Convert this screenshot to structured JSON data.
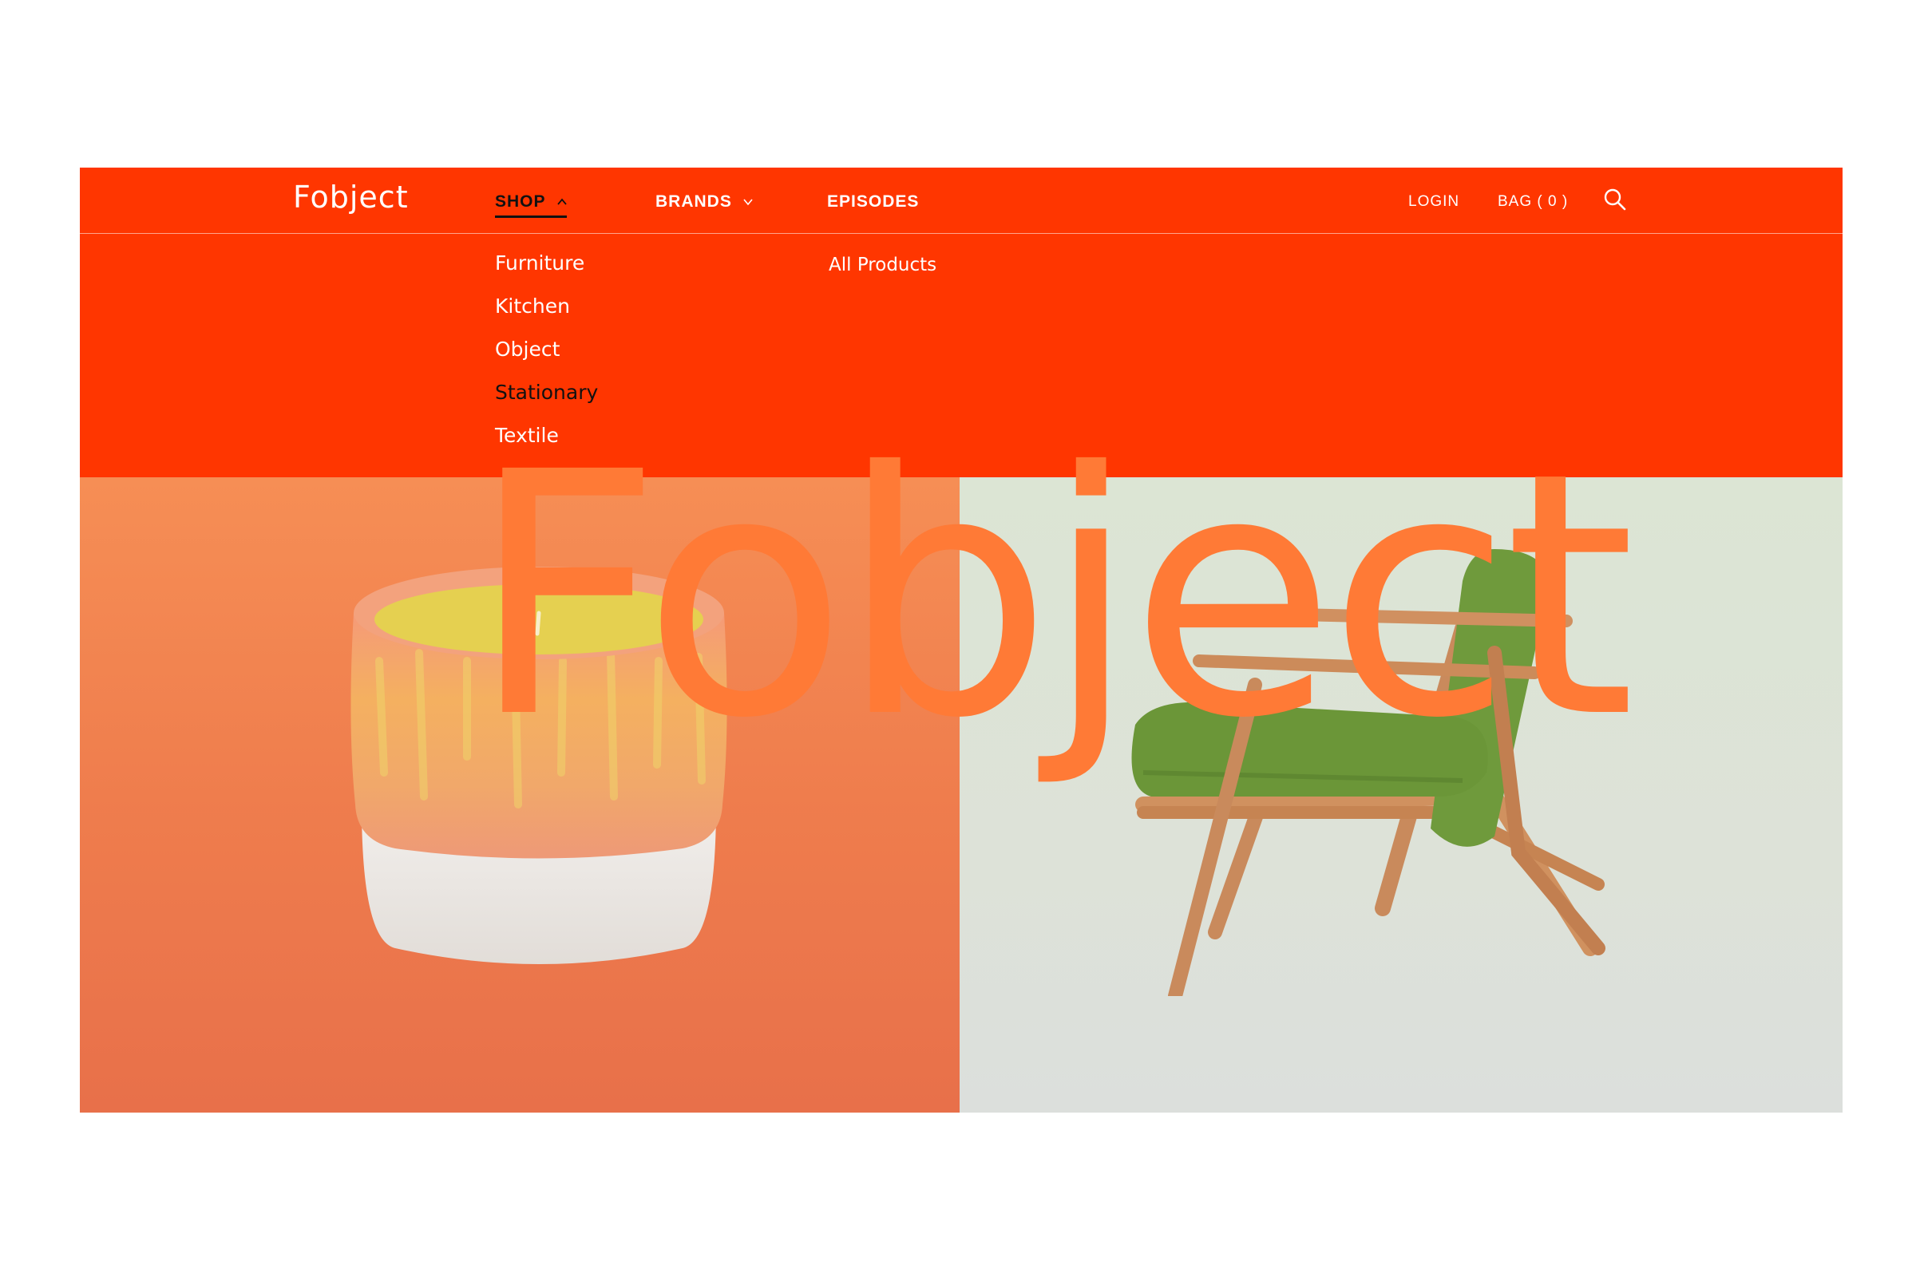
{
  "brand": {
    "logo": "Fobject",
    "accent_color": "#ff3600",
    "watermark_color": "#ff7a36"
  },
  "nav": {
    "shop": "SHOP",
    "brands": "BRANDS",
    "episodes": "EPISODES",
    "active": "SHOP"
  },
  "utility": {
    "login": "LOGIN",
    "bag": "BAG ( 0 )",
    "search_icon": "search-icon"
  },
  "shop_menu": {
    "categories": [
      "Furniture",
      "Kitchen",
      "Object",
      "Stationary",
      "Textile"
    ],
    "hovered": "Stationary",
    "secondary": [
      "All Products"
    ]
  },
  "hero": {
    "watermark": "Fobject",
    "left_item": "candle-icon",
    "right_item": "lounge-chair-icon"
  }
}
